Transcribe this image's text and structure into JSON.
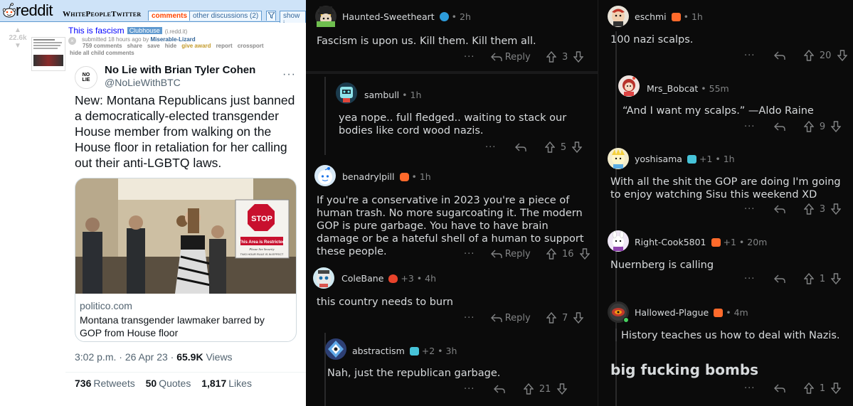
{
  "reddit_header": {
    "wordmark": "reddit",
    "subreddit": "WhitePeopleTwitter",
    "tabs": [
      "comments",
      "other discussions (2)",
      "show i"
    ]
  },
  "post": {
    "score": "22.6k",
    "title": "This is fascism",
    "flair": "Clubhouse",
    "domain": "(i.redd.it)",
    "tagline_prefix": "submitted 18 hours ago by",
    "author": "Miserable-Lizard",
    "buttons": [
      "759 comments",
      "share",
      "save",
      "hide",
      "give award",
      "report",
      "crossport"
    ],
    "hide_children": "hide all child comments"
  },
  "tweet": {
    "name": "No Lie with Brian Tyler Cohen",
    "handle": "@NoLieWithBTC",
    "avatar_text": "NO LIE",
    "more": "···",
    "text": "New: Montana Republicans just banned a democratically-elected transgender House member from walking on the House floor in retaliation for her calling out their anti-LGBTQ laws.",
    "card_domain": "politico.com",
    "card_title": "Montana transgender lawmaker barred by GOP from House floor",
    "sign_stop": "STOP",
    "sign_restricted": "This Area is Restricted",
    "sign_security": "Please See Security",
    "sign_rule": "TWO HOUR RULE IS IN EFFECT",
    "time": "3:02 p.m.",
    "date": "26 Apr 23",
    "views_num": "65.9K",
    "views_label": "Views",
    "retweets_num": "736",
    "retweets_label": "Retweets",
    "quotes_num": "50",
    "quotes_label": "Quotes",
    "likes_num": "1,817",
    "likes_label": "Likes"
  },
  "mid_comments": [
    {
      "user": "Haunted-Sweetheart",
      "time": "2h",
      "text": "Fascism is upon us. Kill them. Kill them all.",
      "reply": "Reply",
      "score": "3",
      "dots": "···"
    },
    {
      "user": "sambull",
      "time": "1h",
      "text": "yea nope.. full fledged.. waiting to stack our bodies like cord wood nazis.",
      "score": "5",
      "dots": "···"
    },
    {
      "user": "benadrylpill",
      "time": "1h",
      "text": "If you're a conservative in 2023 you're a piece of human trash. No more sugarcoating it. The modern GOP is pure garbage. You have to have brain damage or be a hateful shell of a human to support these people.",
      "reply": "Reply",
      "score": "16",
      "dots": "···"
    },
    {
      "user": "ColeBane",
      "extra": "+3",
      "time": "4h",
      "text": "this country needs to burn",
      "reply": "Reply",
      "score": "7",
      "dots": "···"
    },
    {
      "user": "abstractism",
      "extra": "+2",
      "time": "3h",
      "text": "Nah, just the republican garbage.",
      "score": "21",
      "dots": "···"
    }
  ],
  "right_comments": [
    {
      "user": "eschmi",
      "time": "1h",
      "text": "100 nazi scalps.",
      "score": "20",
      "dots": "···"
    },
    {
      "user": "Mrs_Bobcat",
      "time": "55m",
      "text": "“And I want my scalps.” —Aldo Raine",
      "score": "9",
      "dots": "···"
    },
    {
      "user": "yoshisama",
      "extra": "+1",
      "time": "1h",
      "text": "With all the shit the GOP are doing I'm going to enjoy watching Sisu this weekend XD",
      "score": "3",
      "dots": "···"
    },
    {
      "user": "Right-Cook5801",
      "extra": "+1",
      "time": "20m",
      "text": "Nuernberg is calling",
      "score": "1",
      "dots": "···"
    },
    {
      "user": "Hallowed-Plague",
      "time": "4m",
      "text": "History teaches us how to deal with Nazis.",
      "text2": "big fucking bombs",
      "score": "1",
      "dots": "···"
    }
  ],
  "separator": "•",
  "colors": {
    "bg_dark": "#0b0b0b",
    "text_light": "#d7dadc",
    "muted": "#818384",
    "reddit_blue": "#cee3f8",
    "link_blue": "#0000ff"
  }
}
